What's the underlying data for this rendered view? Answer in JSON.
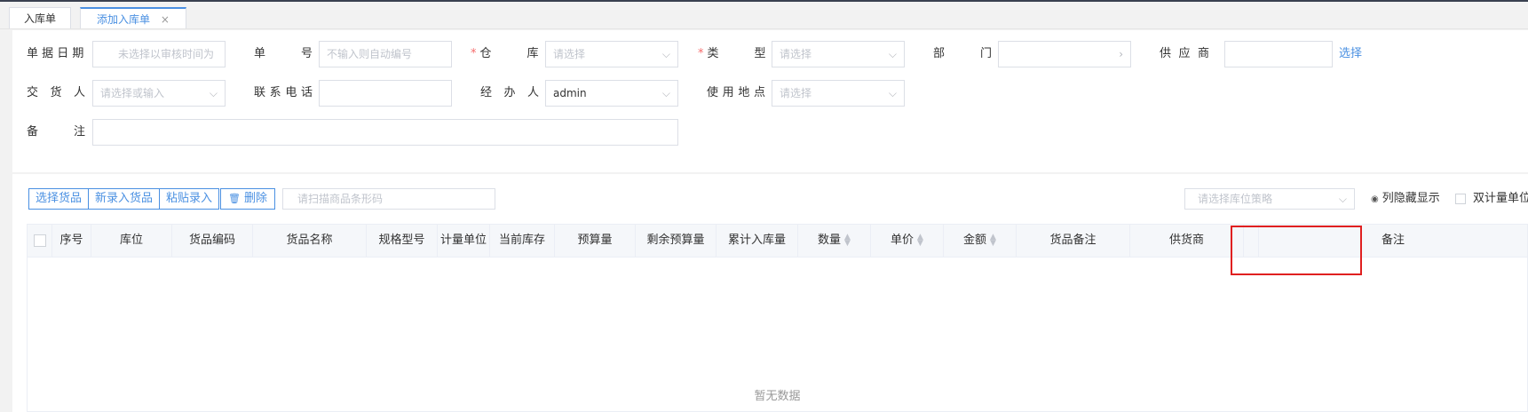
{
  "tabs": [
    {
      "label": "入库单"
    },
    {
      "label": "添加入库单",
      "close": "×"
    }
  ],
  "form": {
    "doc_date": {
      "label": "单 据 日 期",
      "placeholder": "未选择以审核时间为"
    },
    "doc_no": {
      "label": "单 号",
      "placeholder": "不输入则自动编号"
    },
    "warehouse": {
      "required": "*",
      "label": "仓 库",
      "placeholder": "请选择"
    },
    "type": {
      "required": "*",
      "label": "类 型",
      "placeholder": "请选择"
    },
    "department": {
      "label": "部 门",
      "value": ""
    },
    "supplier": {
      "label": "供 应 商",
      "value": "",
      "select_link": "选择"
    },
    "deliverer": {
      "label": "交 货 人",
      "placeholder": "请选择或输入"
    },
    "phone": {
      "label": "联 系 电 话",
      "value": ""
    },
    "handler": {
      "label": "经 办 人",
      "value": "admin"
    },
    "location": {
      "label": "使 用 地 点",
      "placeholder": "请选择"
    },
    "remark": {
      "label": "备 注",
      "value": ""
    }
  },
  "toolbar": {
    "select_goods": "选择货品",
    "new_goods": "新录入货品",
    "paste": "粘贴录入",
    "delete": "删除",
    "barcode_placeholder": "请扫描商品条形码",
    "strategy_placeholder": "请选择库位策略",
    "column_toggle": "列隐藏显示",
    "dual_unit": "双计量单位"
  },
  "table": {
    "columns": [
      "序号",
      "库位",
      "货品编码",
      "货品名称",
      "规格型号",
      "计量单位",
      "当前库存",
      "预算量",
      "剩余预算量",
      "累计入库量",
      "数量",
      "单价",
      "金额",
      "货品备注",
      "供货商",
      "备注"
    ],
    "empty_text": "暂无数据"
  },
  "icons": {
    "chevron_down": "⌵",
    "chevron_right": "›",
    "trash": "🗑",
    "eye": "◉",
    "sort": "▲▼"
  },
  "colors": {
    "accent": "#4a90e2",
    "required": "#f56c6c",
    "highlight": "#e02020"
  }
}
